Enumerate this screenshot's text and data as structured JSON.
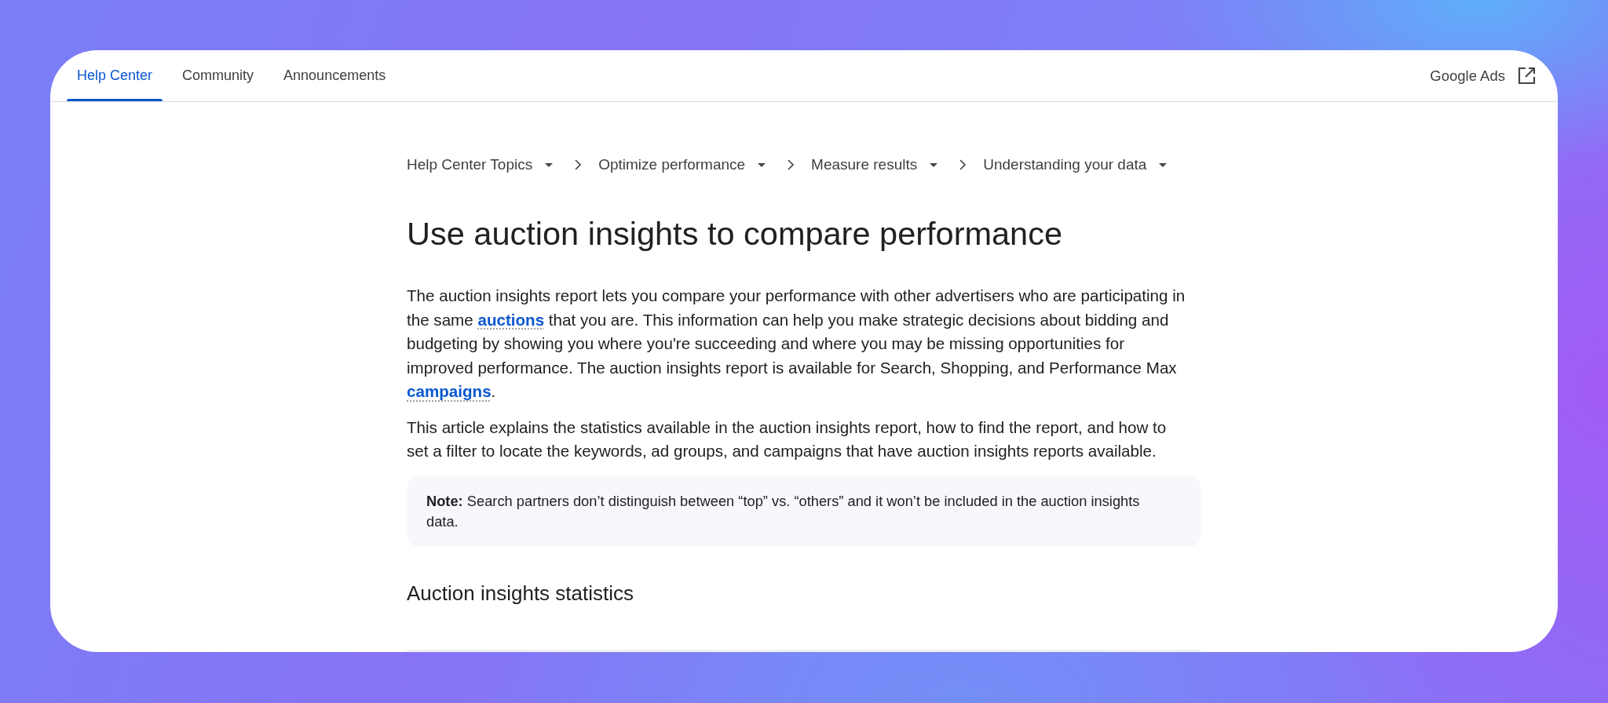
{
  "nav": {
    "tabs": [
      {
        "label": "Help Center",
        "selected": true
      },
      {
        "label": "Community",
        "selected": false
      },
      {
        "label": "Announcements",
        "selected": false
      }
    ],
    "product_link": {
      "label": "Google Ads"
    }
  },
  "breadcrumbs": [
    {
      "label": "Help Center Topics"
    },
    {
      "label": "Optimize performance"
    },
    {
      "label": "Measure results"
    },
    {
      "label": "Understanding your data"
    }
  ],
  "article": {
    "title": "Use auction insights to compare performance",
    "paragraphs": [
      {
        "parts": [
          {
            "kind": "text",
            "text": "The auction insights report lets you compare your performance with other advertisers who are participating in the same "
          },
          {
            "kind": "link",
            "text": "auctions"
          },
          {
            "kind": "text",
            "text": " that you are. This information can help you make strategic decisions about bidding and budgeting by showing you where you're succeeding and where you may be missing opportunities for improved performance. The auction insights report is available for Search, Shopping, and Performance Max "
          },
          {
            "kind": "link",
            "text": "campaigns"
          },
          {
            "kind": "text",
            "text": "."
          }
        ]
      },
      {
        "parts": [
          {
            "kind": "text",
            "text": "This article explains the statistics available in the auction insights report, how to find the report, and how to set a filter to locate the keywords, ad groups, and campaigns that have auction insights reports available."
          }
        ]
      }
    ],
    "note": "**Note:** Search partners don’t distinguish between “top” vs. “others” and it won’t be included in the auction insights data.",
    "section_heading": "Auction insights statistics"
  }
}
